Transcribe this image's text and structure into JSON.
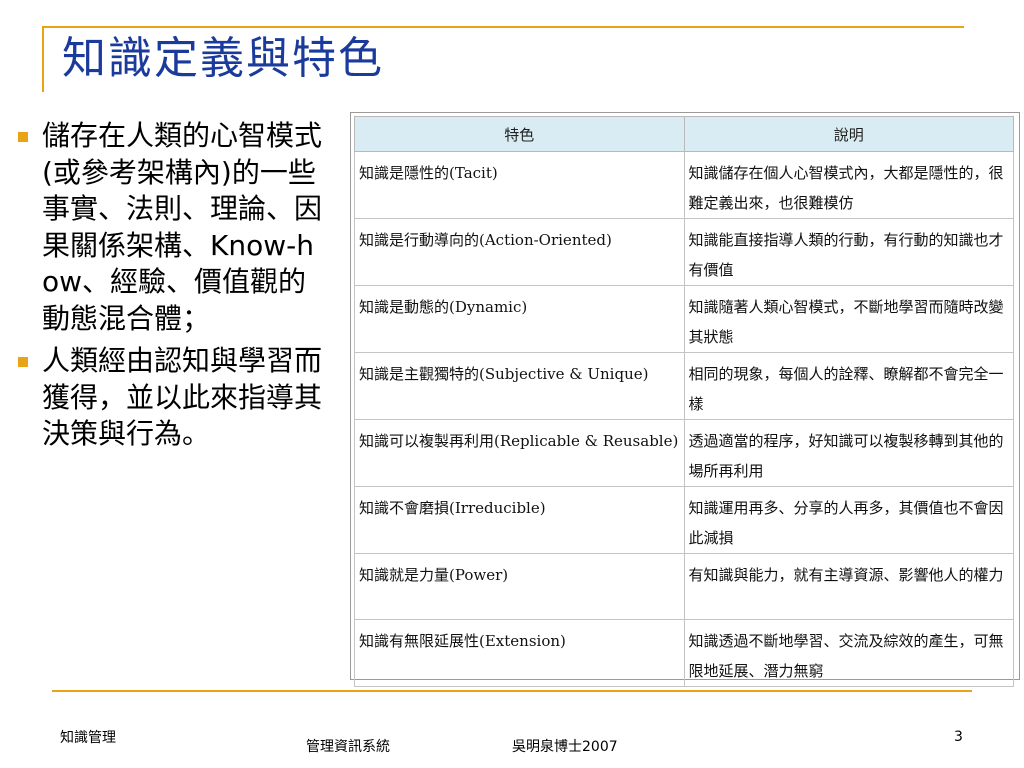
{
  "slide": {
    "title": "知識定義與特色",
    "bullets": [
      "儲存在人類的心智模式(或參考架構內)的一些事實、法則、理論、因果關係架構、Know-how、經驗、價值觀的動態混合體；",
      "人類經由認知與學習而獲得，並以此來指導其決策與行為。"
    ]
  },
  "table": {
    "headers": [
      "特色",
      "說明"
    ],
    "rows": [
      [
        "知識是隱性的(Tacit)",
        "知識儲存在個人心智模式內，大都是隱性的，很難定義出來，也很難模仿"
      ],
      [
        "知識是行動導向的(Action-Oriented)",
        "知識能直接指導人類的行動，有行動的知識也才有價值"
      ],
      [
        "知識是動態的(Dynamic)",
        "知識隨著人類心智模式，不斷地學習而隨時改變其狀態"
      ],
      [
        "知識是主觀獨特的(Subjective & Unique)",
        "相同的現象，每個人的詮釋、瞭解都不會完全一樣"
      ],
      [
        "知識可以複製再利用(Replicable & Reusable)",
        "透過適當的程序，好知識可以複製移轉到其他的場所再利用"
      ],
      [
        "知識不會磨損(Irreducible)",
        "知識運用再多、分享的人再多，其價值也不會因此減損"
      ],
      [
        "知識就是力量(Power)",
        "有知識與能力，就有主導資源、影響他人的權力"
      ],
      [
        "知識有無限延展性(Extension)",
        "知識透過不斷地學習、交流及綜效的產生，可無限地延展、潛力無窮"
      ]
    ]
  },
  "footer": {
    "left": "知識管理",
    "course": "管理資訊系統",
    "author": "吳明泉博士2007",
    "page": "3"
  },
  "colors": {
    "accent": "#e8a317",
    "title": "#1a3a9c",
    "header_bg": "#d9ecf3"
  }
}
